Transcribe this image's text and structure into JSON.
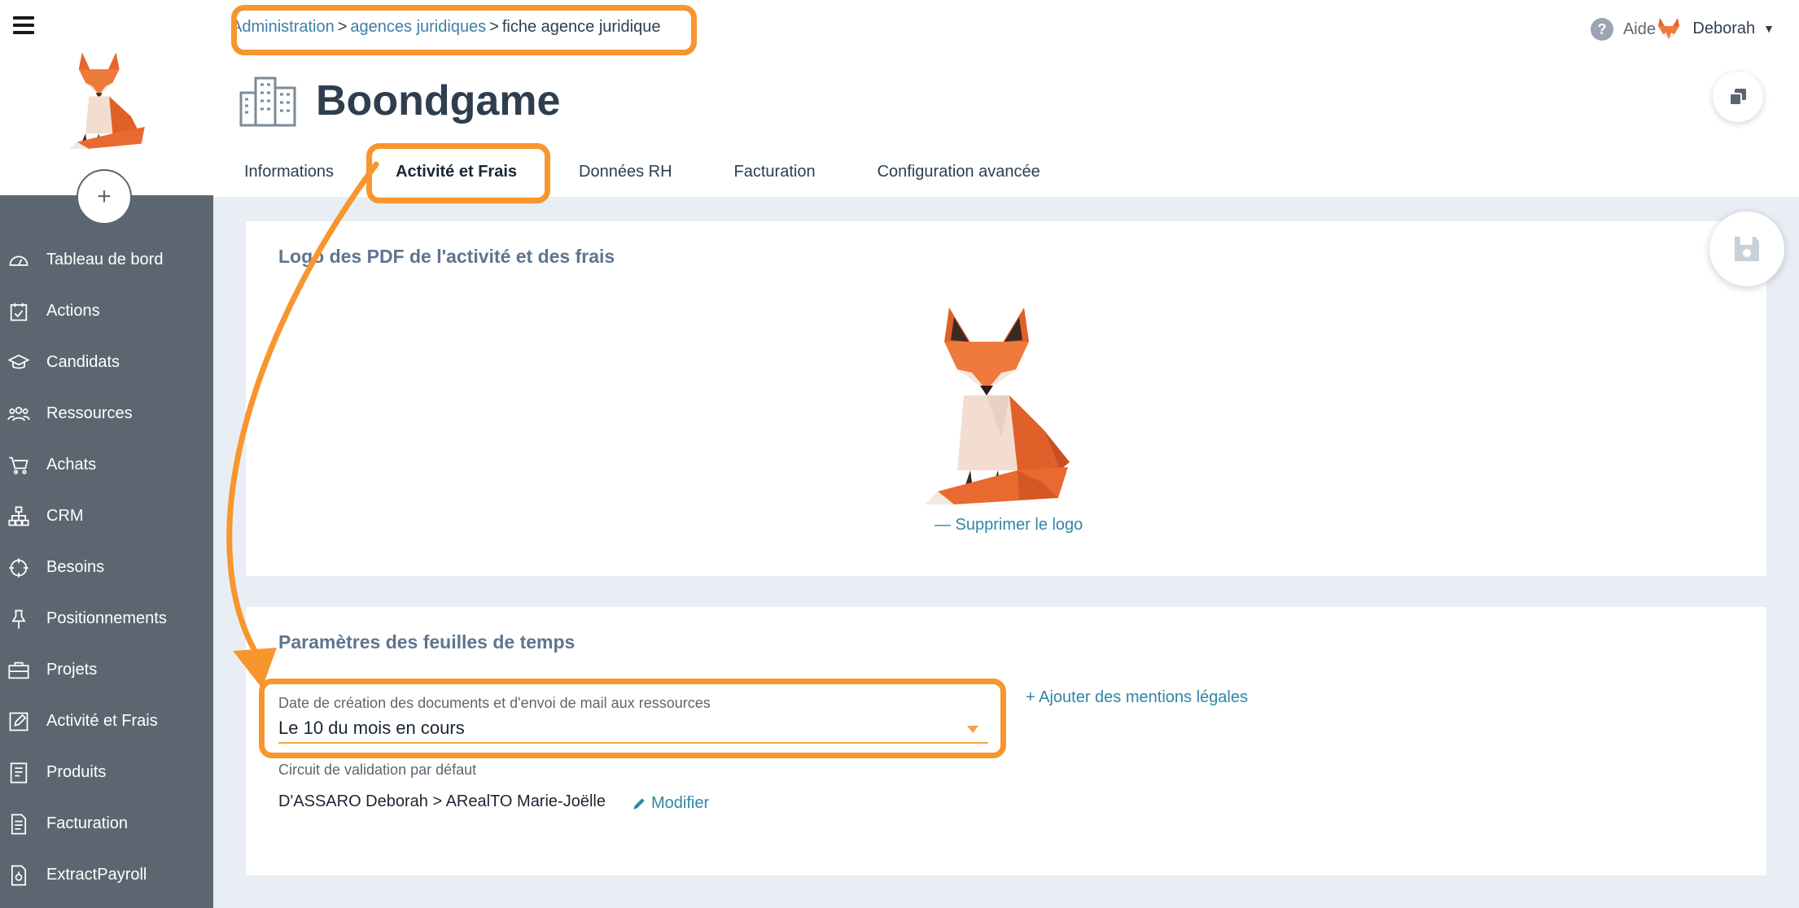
{
  "sidebar": {
    "items": [
      {
        "label": "Tableau de bord",
        "icon": "dashboard-icon"
      },
      {
        "label": "Actions",
        "icon": "calendar-check-icon"
      },
      {
        "label": "Candidats",
        "icon": "graduation-cap-icon"
      },
      {
        "label": "Ressources",
        "icon": "people-icon"
      },
      {
        "label": "Achats",
        "icon": "cart-icon"
      },
      {
        "label": "CRM",
        "icon": "org-chart-icon"
      },
      {
        "label": "Besoins",
        "icon": "crosshair-icon"
      },
      {
        "label": "Positionnements",
        "icon": "pin-icon"
      },
      {
        "label": "Projets",
        "icon": "briefcase-icon"
      },
      {
        "label": "Activité et Frais",
        "icon": "edit-icon"
      },
      {
        "label": "Produits",
        "icon": "book-icon"
      },
      {
        "label": "Facturation",
        "icon": "invoice-icon"
      },
      {
        "label": "ExtractPayroll",
        "icon": "file-export-icon"
      }
    ],
    "add_label": "+"
  },
  "header": {
    "breadcrumb": [
      "Administration",
      "agences juridiques",
      "fiche agence juridique"
    ],
    "help_label": "Aide",
    "user_name": "Deborah",
    "title": "Boondgame",
    "tabs": [
      "Informations",
      "Activité et Frais",
      "Données RH",
      "Facturation",
      "Configuration avancée"
    ],
    "active_tab": "Activité et Frais"
  },
  "logo_card": {
    "title": "Logo des PDF de l'activité et des frais",
    "delete_label": "— Supprimer le logo"
  },
  "params_card": {
    "title": "Paramètres des feuilles de temps",
    "field_label": "Date de création des documents et d'envoi de mail aux ressources",
    "field_value": "Le 10 du mois en cours",
    "legal_link": "+ Ajouter des mentions légales",
    "circuit_label": "Circuit de validation par défaut",
    "circuit_value": "D'ASSARO Deborah > ARealTO Marie-Joëlle",
    "modify_label": "Modifier"
  },
  "colors": {
    "sidebar": "#5c6670",
    "accent_orange": "#f7962d",
    "link_blue": "#2f86a6",
    "fox_orange": "#e8642a"
  }
}
